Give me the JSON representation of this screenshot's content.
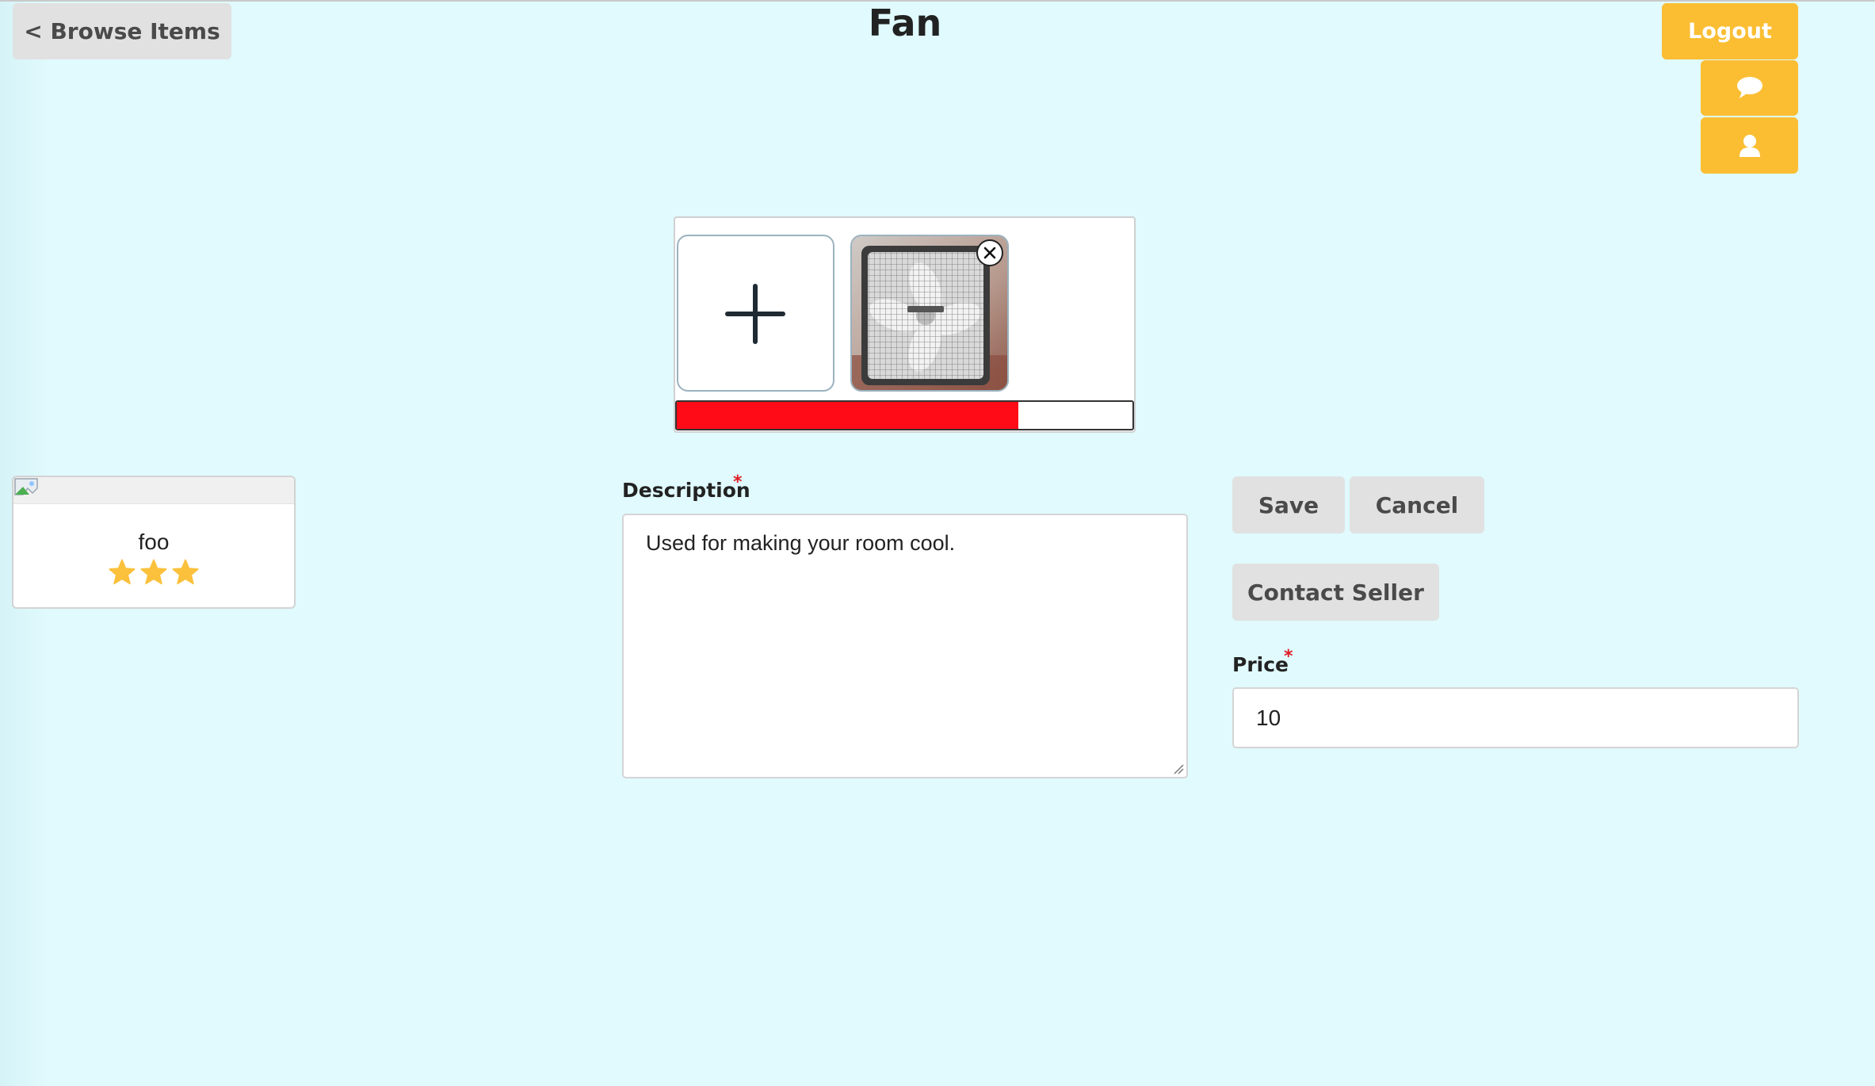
{
  "header": {
    "back_label": "< Browse Items",
    "title": "Fan",
    "logout_label": "Logout",
    "messages_icon": "chat-bubble-icon",
    "profile_icon": "user-icon"
  },
  "uploader": {
    "add_icon": "plus-icon",
    "photo_alt": "Box fan photo",
    "remove_icon": "close-icon",
    "progress_fraction": 0.75,
    "progress_color": "#fe0b17"
  },
  "item_card": {
    "title": "foo",
    "rating_stars": 3,
    "star_color": "#fbc13c"
  },
  "form": {
    "description_label": "Description",
    "description_required": "*",
    "description_value": "Used for making your room cool.",
    "price_label": "Price",
    "price_required": "*",
    "price_value": "10"
  },
  "actions": {
    "save_label": "Save",
    "cancel_label": "Cancel",
    "contact_label": "Contact Seller"
  },
  "colors": {
    "background": "#e0fafd",
    "accent": "#fbbe33",
    "button_grey": "#e1e1e1",
    "required": "#e01b24"
  }
}
